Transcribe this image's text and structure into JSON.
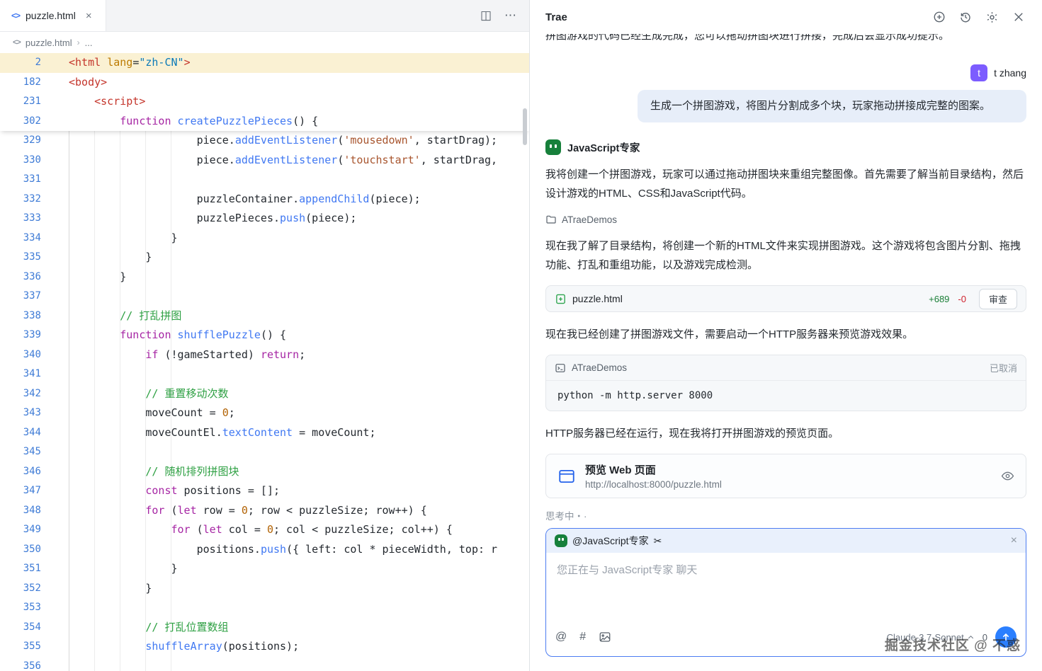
{
  "editor": {
    "tab": {
      "icon": "<>",
      "title": "puzzle.html",
      "close": "×",
      "split": "◫",
      "more": "⋯"
    },
    "breadcrumb": {
      "icon": "<>",
      "file": "puzzle.html",
      "sep": "›",
      "more": "..."
    },
    "sticky": [
      {
        "n": "2",
        "hl": true,
        "t": [
          [
            "tag",
            "<html"
          ],
          [
            "plain",
            " "
          ],
          [
            "attr",
            "lang"
          ],
          [
            "op",
            "="
          ],
          [
            "strv",
            "\"zh-CN\""
          ],
          [
            "tag",
            ">"
          ]
        ]
      },
      {
        "n": "182",
        "t": [
          [
            "tag",
            "<body>"
          ]
        ]
      },
      {
        "n": "231",
        "t": [
          [
            "plain",
            "    "
          ],
          [
            "tag",
            "<script>"
          ]
        ]
      },
      {
        "n": "302",
        "t": [
          [
            "plain",
            "        "
          ],
          [
            "kw",
            "function"
          ],
          [
            "plain",
            " "
          ],
          [
            "fn",
            "createPuzzlePieces"
          ],
          [
            "plain",
            "() {"
          ]
        ]
      }
    ],
    "lines": [
      {
        "n": "329",
        "t": [
          [
            "plain",
            "                    piece."
          ],
          [
            "fn",
            "addEventListener"
          ],
          [
            "plain",
            "("
          ],
          [
            "str",
            "'mousedown'"
          ],
          [
            "plain",
            ", startDrag);"
          ]
        ]
      },
      {
        "n": "330",
        "t": [
          [
            "plain",
            "                    piece."
          ],
          [
            "fn",
            "addEventListener"
          ],
          [
            "plain",
            "("
          ],
          [
            "str",
            "'touchstart'"
          ],
          [
            "plain",
            ", startDrag, "
          ]
        ]
      },
      {
        "n": "331",
        "t": []
      },
      {
        "n": "332",
        "t": [
          [
            "plain",
            "                    puzzleContainer."
          ],
          [
            "fn",
            "appendChild"
          ],
          [
            "plain",
            "(piece);"
          ]
        ]
      },
      {
        "n": "333",
        "t": [
          [
            "plain",
            "                    puzzlePieces."
          ],
          [
            "fn",
            "push"
          ],
          [
            "plain",
            "(piece);"
          ]
        ]
      },
      {
        "n": "334",
        "t": [
          [
            "plain",
            "                }"
          ]
        ]
      },
      {
        "n": "335",
        "t": [
          [
            "plain",
            "            }"
          ]
        ]
      },
      {
        "n": "336",
        "t": [
          [
            "plain",
            "        }"
          ]
        ]
      },
      {
        "n": "337",
        "t": []
      },
      {
        "n": "338",
        "t": [
          [
            "plain",
            "        "
          ],
          [
            "com",
            "// 打乱拼图"
          ]
        ]
      },
      {
        "n": "339",
        "t": [
          [
            "plain",
            "        "
          ],
          [
            "kw",
            "function"
          ],
          [
            "plain",
            " "
          ],
          [
            "fn",
            "shufflePuzzle"
          ],
          [
            "plain",
            "() {"
          ]
        ]
      },
      {
        "n": "340",
        "t": [
          [
            "plain",
            "            "
          ],
          [
            "kw",
            "if"
          ],
          [
            "plain",
            " (!gameStarted) "
          ],
          [
            "kw",
            "return"
          ],
          [
            "plain",
            ";"
          ]
        ]
      },
      {
        "n": "341",
        "t": []
      },
      {
        "n": "342",
        "t": [
          [
            "plain",
            "            "
          ],
          [
            "com",
            "// 重置移动次数"
          ]
        ]
      },
      {
        "n": "343",
        "t": [
          [
            "plain",
            "            moveCount = "
          ],
          [
            "num",
            "0"
          ],
          [
            "plain",
            ";"
          ]
        ]
      },
      {
        "n": "344",
        "t": [
          [
            "plain",
            "            moveCountEl."
          ],
          [
            "fn",
            "textContent"
          ],
          [
            "plain",
            " = moveCount;"
          ]
        ]
      },
      {
        "n": "345",
        "t": []
      },
      {
        "n": "346",
        "t": [
          [
            "plain",
            "            "
          ],
          [
            "com",
            "// 随机排列拼图块"
          ]
        ]
      },
      {
        "n": "347",
        "t": [
          [
            "plain",
            "            "
          ],
          [
            "kw",
            "const"
          ],
          [
            "plain",
            " positions = [];"
          ]
        ]
      },
      {
        "n": "348",
        "t": [
          [
            "plain",
            "            "
          ],
          [
            "kw",
            "for"
          ],
          [
            "plain",
            " ("
          ],
          [
            "kw",
            "let"
          ],
          [
            "plain",
            " row = "
          ],
          [
            "num",
            "0"
          ],
          [
            "plain",
            "; row < puzzleSize; row++) {"
          ]
        ]
      },
      {
        "n": "349",
        "t": [
          [
            "plain",
            "                "
          ],
          [
            "kw",
            "for"
          ],
          [
            "plain",
            " ("
          ],
          [
            "kw",
            "let"
          ],
          [
            "plain",
            " col = "
          ],
          [
            "num",
            "0"
          ],
          [
            "plain",
            "; col < puzzleSize; col++) {"
          ]
        ]
      },
      {
        "n": "350",
        "t": [
          [
            "plain",
            "                    positions."
          ],
          [
            "fn",
            "push"
          ],
          [
            "plain",
            "({ left: col * pieceWidth, top: r"
          ]
        ]
      },
      {
        "n": "351",
        "t": [
          [
            "plain",
            "                }"
          ]
        ]
      },
      {
        "n": "352",
        "t": [
          [
            "plain",
            "            }"
          ]
        ]
      },
      {
        "n": "353",
        "t": []
      },
      {
        "n": "354",
        "t": [
          [
            "plain",
            "            "
          ],
          [
            "com",
            "// 打乱位置数组"
          ]
        ]
      },
      {
        "n": "355",
        "t": [
          [
            "plain",
            "            "
          ],
          [
            "fn",
            "shuffleArray"
          ],
          [
            "plain",
            "(positions);"
          ]
        ]
      },
      {
        "n": "356",
        "t": []
      }
    ]
  },
  "chat": {
    "title": "Trae",
    "clipped": "拼图游戏的代码已经生成完成，您可以拖动拼图块进行拼接，完成后会显示成功提示。",
    "user": {
      "avatar": "t",
      "name": "t zhang",
      "message": "生成一个拼图游戏，将图片分割成多个块，玩家拖动拼接成完整的图案。"
    },
    "agent": {
      "name": "JavaScript专家"
    },
    "p1": "我将创建一个拼图游戏，玩家可以通过拖动拼图块来重组完整图像。首先需要了解当前目录结构，然后设计游戏的HTML、CSS和JavaScript代码。",
    "workspace": "ATraeDemos",
    "p2": "现在我了解了目录结构，将创建一个新的HTML文件来实现拼图游戏。这个游戏将包含图片分割、拖拽功能、打乱和重组功能，以及游戏完成检测。",
    "file_card": {
      "filename": "puzzle.html",
      "added": "+689",
      "removed": "-0",
      "review_label": "审查"
    },
    "p3": "现在我已经创建了拼图游戏文件，需要启动一个HTTP服务器来预览游戏效果。",
    "terminal": {
      "workspace": "ATraeDemos",
      "status": "已取消",
      "command": "python -m http.server 8000"
    },
    "p4": "HTTP服务器已经在运行，现在我将打开拼图游戏的预览页面。",
    "preview": {
      "title": "预览 Web 页面",
      "url": "http://localhost:8000/puzzle.html"
    },
    "thinking": "思考中・·"
  },
  "composer": {
    "mention": "@JavaScript专家",
    "scissors_glyph": "✂",
    "close": "×",
    "placeholder": "您正在与 JavaScript专家 聊天",
    "at_glyph": "@",
    "hash_glyph": "#",
    "model": "Claude-3.7-Sonnet",
    "counter": "0"
  },
  "watermark": "掘金技术社区 @ 不惑"
}
